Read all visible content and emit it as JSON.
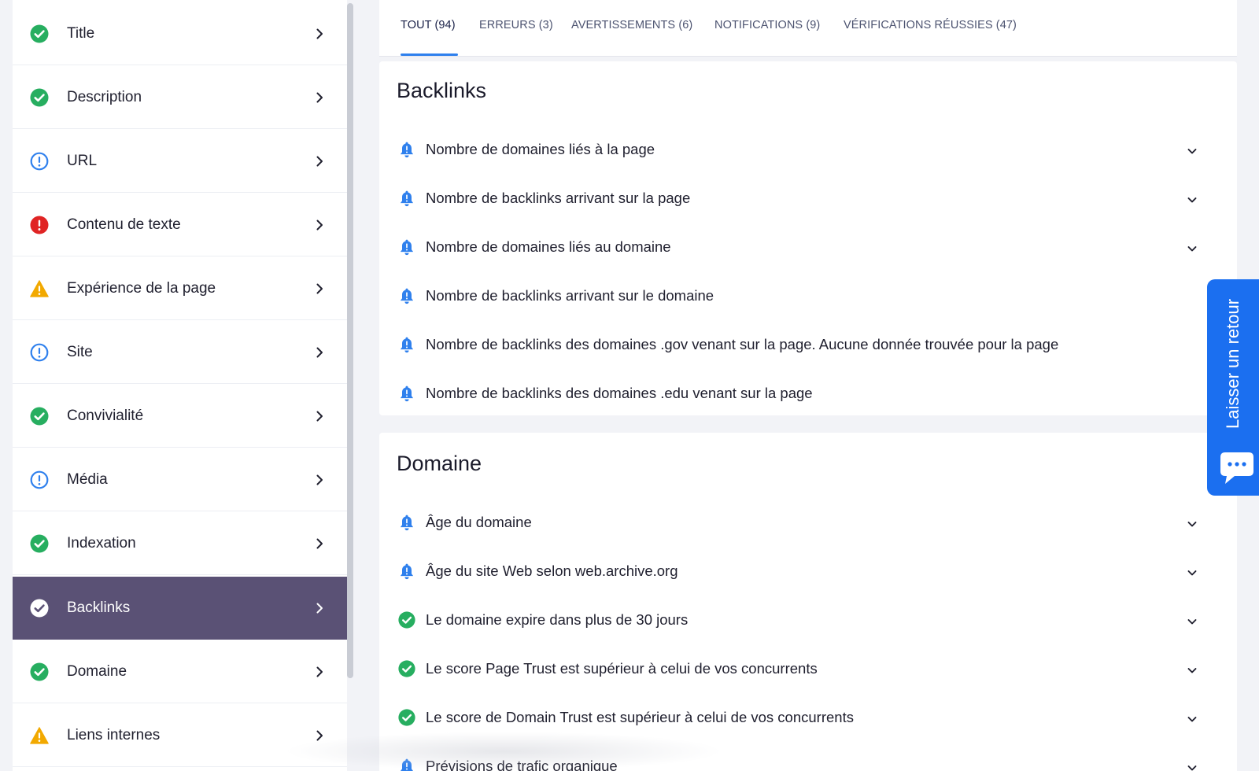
{
  "colors": {
    "accent": "#2f80ed",
    "success": "#27ae60",
    "info": "#2f80ed",
    "error": "#e02424",
    "warning": "#f2a900",
    "active_sidebar": "#5a5175",
    "feedback": "#1b6ff0"
  },
  "sidebar": {
    "items": [
      {
        "label": "Title",
        "status": "success",
        "icon": "check-circle-icon"
      },
      {
        "label": "Description",
        "status": "success",
        "icon": "check-circle-icon"
      },
      {
        "label": "URL",
        "status": "info",
        "icon": "info-circle-icon"
      },
      {
        "label": "Contenu de texte",
        "status": "error",
        "icon": "error-circle-icon"
      },
      {
        "label": "Expérience de la page",
        "status": "warning",
        "icon": "warning-triangle-icon"
      },
      {
        "label": "Site",
        "status": "info",
        "icon": "info-circle-icon"
      },
      {
        "label": "Convivialité",
        "status": "success",
        "icon": "check-circle-icon"
      },
      {
        "label": "Média",
        "status": "info",
        "icon": "info-circle-icon"
      },
      {
        "label": "Indexation",
        "status": "success",
        "icon": "check-circle-icon"
      },
      {
        "label": "Backlinks",
        "status": "success",
        "icon": "check-circle-icon",
        "active": true
      },
      {
        "label": "Domaine",
        "status": "success",
        "icon": "check-circle-icon"
      },
      {
        "label": "Liens internes",
        "status": "warning",
        "icon": "warning-triangle-icon"
      }
    ]
  },
  "tabs": [
    {
      "label": "TOUT (94)",
      "active": true
    },
    {
      "label": "ERREURS (3)"
    },
    {
      "label": "AVERTISSEMENTS (6)"
    },
    {
      "label": "NOTIFICATIONS (9)"
    },
    {
      "label": "VÉRIFICATIONS RÉUSSIES (47)"
    }
  ],
  "sections": [
    {
      "title": "Backlinks",
      "items": [
        {
          "label": "Nombre de domaines liés à la page",
          "icon": "bell-icon"
        },
        {
          "label": "Nombre de backlinks arrivant sur la page",
          "icon": "bell-icon"
        },
        {
          "label": "Nombre de domaines liés au domaine",
          "icon": "bell-icon"
        },
        {
          "label": "Nombre de backlinks arrivant sur le domaine",
          "icon": "bell-icon"
        },
        {
          "label": "Nombre de backlinks des domaines .gov venant sur la page. Aucune donnée trouvée pour la page",
          "icon": "bell-icon"
        },
        {
          "label": "Nombre de backlinks des domaines .edu venant sur la page",
          "icon": "bell-icon"
        }
      ]
    },
    {
      "title": "Domaine",
      "items": [
        {
          "label": "Âge du domaine",
          "icon": "bell-icon"
        },
        {
          "label": "Âge du site Web selon web.archive.org",
          "icon": "bell-icon"
        },
        {
          "label": "Le domaine expire dans plus de 30 jours",
          "icon": "check-circle-icon"
        },
        {
          "label": "Le score Page Trust est supérieur à celui de vos concurrents",
          "icon": "check-circle-icon"
        },
        {
          "label": "Le score de Domain Trust est supérieur à celui de vos concurrents",
          "icon": "check-circle-icon"
        },
        {
          "label": "Prévisions de trafic organique",
          "icon": "bell-icon"
        }
      ]
    }
  ],
  "feedback": {
    "label": "Laisser un retour",
    "icon": "chat-bubble-icon"
  }
}
